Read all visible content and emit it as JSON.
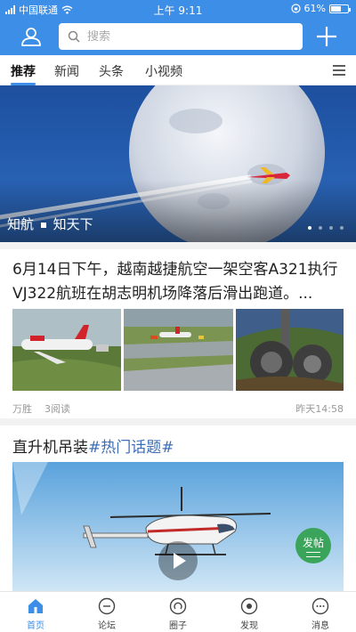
{
  "status_bar": {
    "carrier": "中国联通",
    "time": "上午 9:11",
    "battery": "61%",
    "battery_level": 0.61
  },
  "header": {
    "search_placeholder": "搜索",
    "icons": [
      "user-icon",
      "search-icon",
      "plus-icon"
    ]
  },
  "tabs": {
    "items": [
      {
        "label": "推荐",
        "active": true
      },
      {
        "label": "新闻",
        "active": false
      },
      {
        "label": "头条",
        "active": false
      },
      {
        "label": "小视频",
        "active": false
      }
    ],
    "menu_icon": "hamburger-menu-icon"
  },
  "banner": {
    "caption_left": "知航",
    "caption_right": "知天下",
    "slide_count": 4,
    "active_slide": 1
  },
  "articles": [
    {
      "title": "6月14日下午，越南越捷航空一架空客A321执行VJ322航班在胡志明机场降落后滑出跑道。...",
      "author": "万胜",
      "reads": "3阅读",
      "time": "昨天14:58"
    },
    {
      "title": "直升机吊装",
      "tag": "#热门话题#",
      "badge": "发帖"
    }
  ],
  "bottom_nav": {
    "items": [
      {
        "label": "首页",
        "icon": "home-icon",
        "active": true
      },
      {
        "label": "论坛",
        "icon": "forum-icon",
        "active": false
      },
      {
        "label": "圈子",
        "icon": "circle-icon",
        "active": false
      },
      {
        "label": "发现",
        "icon": "discover-icon",
        "active": false
      },
      {
        "label": "消息",
        "icon": "message-icon",
        "active": false
      }
    ]
  },
  "colors": {
    "brand_blue": "#3d8ee6",
    "tag_blue": "#3d6fb6",
    "badge_green": "#3aa55a"
  }
}
